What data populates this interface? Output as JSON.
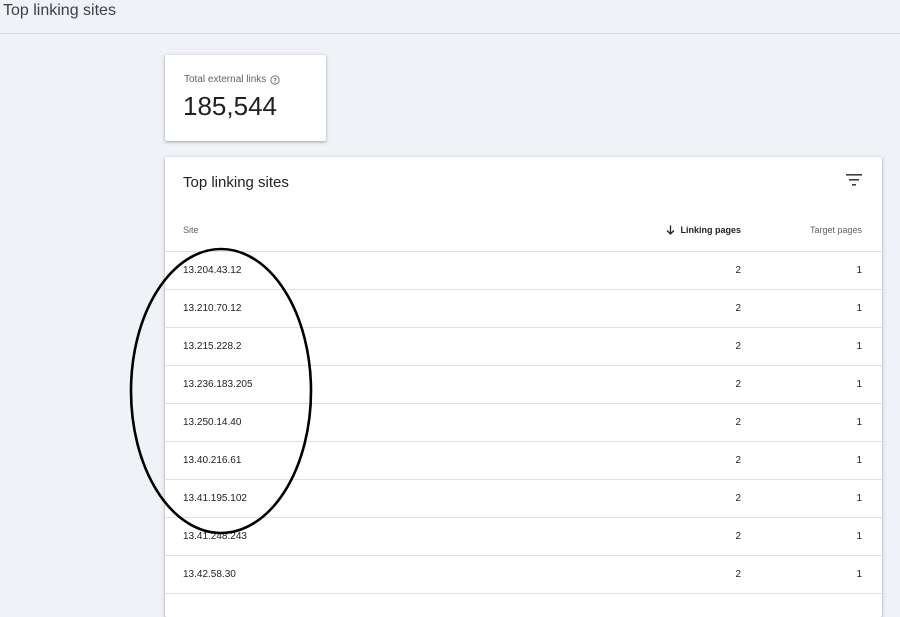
{
  "header": {
    "title": "Top linking sites"
  },
  "summary_card": {
    "label": "Total external links",
    "help_icon": "help-circle-icon",
    "value": "185,544"
  },
  "table": {
    "title": "Top linking sites",
    "filter_icon": "filter-icon",
    "columns": {
      "site": "Site",
      "linking_pages": "Linking pages",
      "target_pages": "Target pages"
    },
    "sort_icon": "arrow-down-icon",
    "rows": [
      {
        "site": "13.204.43.12",
        "linking_pages": "2",
        "target_pages": "1"
      },
      {
        "site": "13.210.70.12",
        "linking_pages": "2",
        "target_pages": "1"
      },
      {
        "site": "13.215.228.2",
        "linking_pages": "2",
        "target_pages": "1"
      },
      {
        "site": "13.236.183.205",
        "linking_pages": "2",
        "target_pages": "1"
      },
      {
        "site": "13.250.14.40",
        "linking_pages": "2",
        "target_pages": "1"
      },
      {
        "site": "13.40.216.61",
        "linking_pages": "2",
        "target_pages": "1"
      },
      {
        "site": "13.41.195.102",
        "linking_pages": "2",
        "target_pages": "1"
      },
      {
        "site": "13.41.248.243",
        "linking_pages": "2",
        "target_pages": "1"
      },
      {
        "site": "13.42.58.30",
        "linking_pages": "2",
        "target_pages": "1"
      }
    ]
  },
  "colors": {
    "background": "#eff2f7",
    "card": "#ffffff",
    "annotation": "#000000"
  }
}
